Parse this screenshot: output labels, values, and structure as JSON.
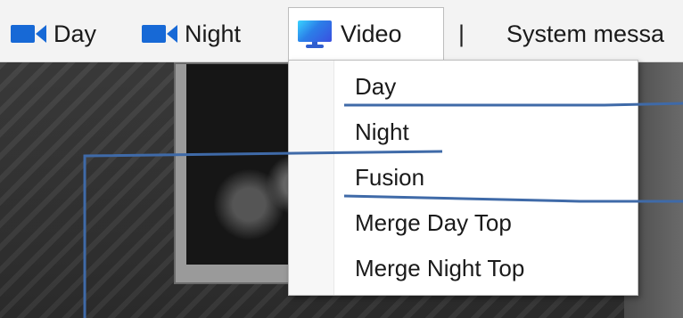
{
  "menubar": {
    "items": [
      {
        "label": "Day",
        "icon": "camera-icon"
      },
      {
        "label": "Night",
        "icon": "camera-icon"
      },
      {
        "label": "Video",
        "icon": "monitor-icon",
        "active": true
      },
      {
        "label": "|"
      },
      {
        "label": "System messa"
      }
    ]
  },
  "video_menu": {
    "items": [
      {
        "label": "Day"
      },
      {
        "label": "Night"
      },
      {
        "label": "Fusion"
      },
      {
        "label": "Merge Day Top"
      },
      {
        "label": "Merge Night Top"
      }
    ]
  },
  "colors": {
    "accent": "#1769d6",
    "annotation": "#3f6aa8",
    "menubar_bg": "#f3f3f3",
    "menu_bg": "#ffffff"
  }
}
